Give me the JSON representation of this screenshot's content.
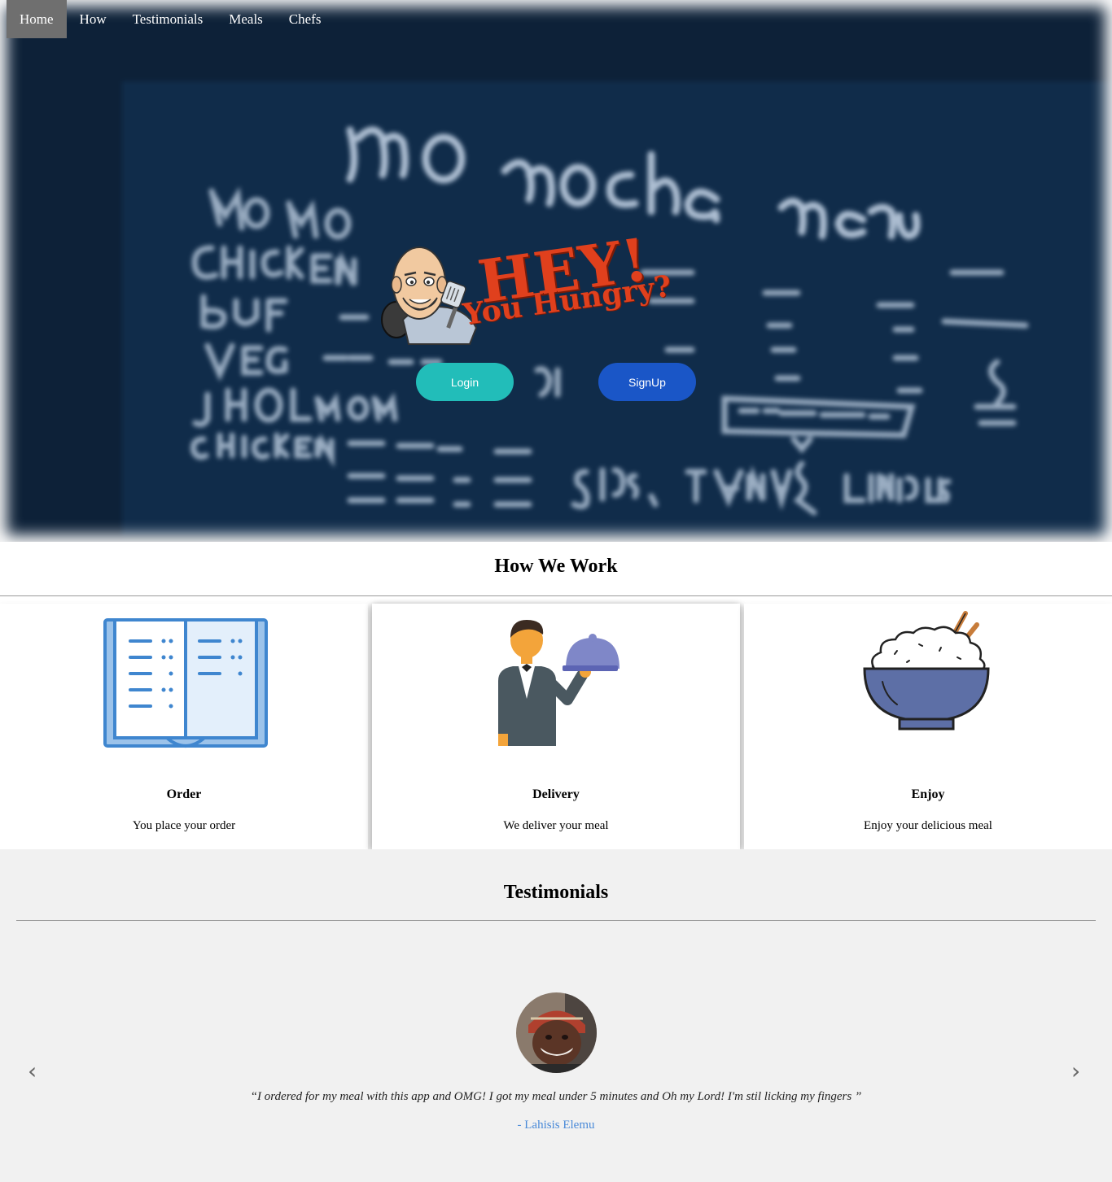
{
  "nav": {
    "items": [
      {
        "label": "Home",
        "active": true
      },
      {
        "label": "How",
        "active": false
      },
      {
        "label": "Testimonials",
        "active": false
      },
      {
        "label": "Meals",
        "active": false
      },
      {
        "label": "Chefs",
        "active": false
      }
    ]
  },
  "hero": {
    "headline": "HEY!",
    "subheadline": "You Hungry?",
    "login_label": "Login",
    "signup_label": "SignUp",
    "colors": {
      "login": "#22bdb9",
      "signup": "#1a56c7",
      "headline": "#e0401d"
    }
  },
  "how": {
    "title": "How We Work",
    "cards": [
      {
        "icon": "menu-book-icon",
        "title": "Order",
        "text": "You place your order"
      },
      {
        "icon": "waiter-cloche-icon",
        "title": "Delivery",
        "text": "We deliver your meal"
      },
      {
        "icon": "rice-bowl-icon",
        "title": "Enjoy",
        "text": "Enjoy your delicious meal"
      }
    ]
  },
  "testimonials": {
    "title": "Testimonials",
    "quote": "“I ordered for my meal with this app and OMG! I got my meal under 5 minutes and Oh my Lord! I'm stil licking my fingers ”",
    "author": "- Lahisis Elemu",
    "prev": "‹",
    "next": "›"
  }
}
